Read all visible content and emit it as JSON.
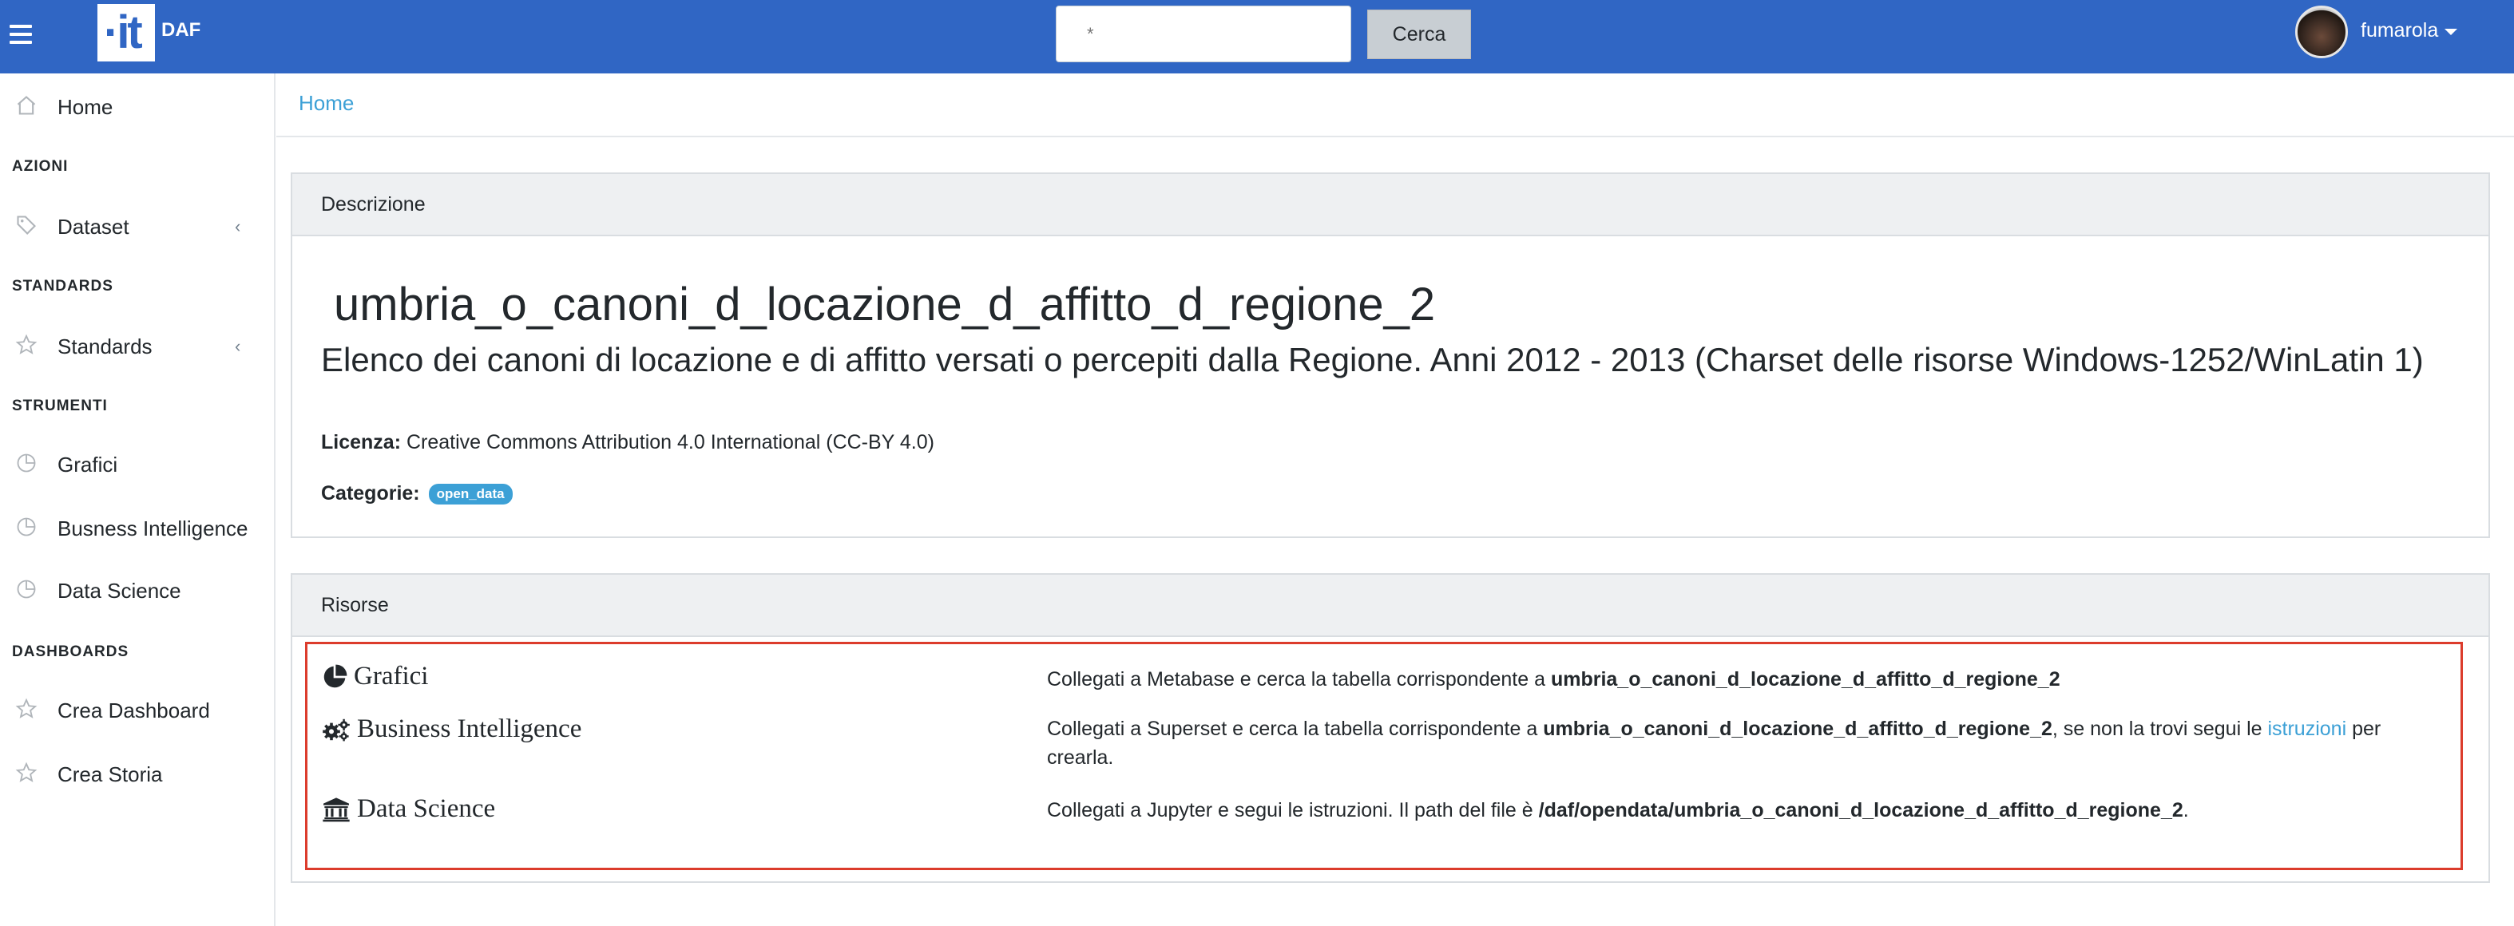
{
  "navbar": {
    "brand": "DAF",
    "logo_text": "·it",
    "search_placeholder": "*",
    "search_button": "Cerca",
    "username": "fumarola"
  },
  "sidebar": {
    "home": "Home",
    "sections": {
      "azioni": "AZIONI",
      "standards": "STANDARDS",
      "strumenti": "STRUMENTI",
      "dashboards": "DASHBOARDS"
    },
    "items": {
      "dataset": "Dataset",
      "standards": "Standards",
      "grafici": "Grafici",
      "business_intelligence": "Busness Intelligence",
      "data_science": "Data Science",
      "crea_dashboard": "Crea Dashboard",
      "crea_storia": "Crea Storia"
    },
    "chevron": "‹"
  },
  "breadcrumb": {
    "home": "Home"
  },
  "descrizione": {
    "header": "Descrizione",
    "title": "umbria_o_canoni_d_locazione_d_affitto_d_regione_2",
    "description": "Elenco dei canoni di locazione e di affitto versati o percepiti dalla Regione. Anni 2012 - 2013 (Charset delle risorse Windows-1252/WinLatin 1)",
    "license_label": "Licenza:",
    "license_value": "Creative Commons Attribution 4.0 International (CC-BY 4.0)",
    "category_label": "Categorie:",
    "category_badge": "open_data"
  },
  "risorse": {
    "header": "Risorse",
    "items": {
      "grafici": {
        "name": "Grafici",
        "text_before": "Collegati a Metabase e cerca la tabella corrispondente a ",
        "table": "umbria_o_canoni_d_locazione_d_affitto_d_regione_2"
      },
      "bi": {
        "name": "Business Intelligence",
        "text_before": "Collegati a Superset e cerca la tabella corrispondente a ",
        "table": "umbria_o_canoni_d_locazione_d_affitto_d_regione_2",
        "text_middle": ", se non la trovi segui le ",
        "link": "istruzioni",
        "text_after": " per crearla."
      },
      "ds": {
        "name": "Data Science",
        "text_before": "Collegati a Jupyter e segui le istruzioni. Il path del file è ",
        "path": "/daf/opendata/umbria_o_canoni_d_locazione_d_affitto_d_regione_2",
        "text_after": "."
      }
    }
  },
  "colors": {
    "navbar": "#3066c4",
    "link": "#3ca0d6",
    "highlight_border": "#dc3c2c",
    "card_header": "#eef0f2"
  }
}
